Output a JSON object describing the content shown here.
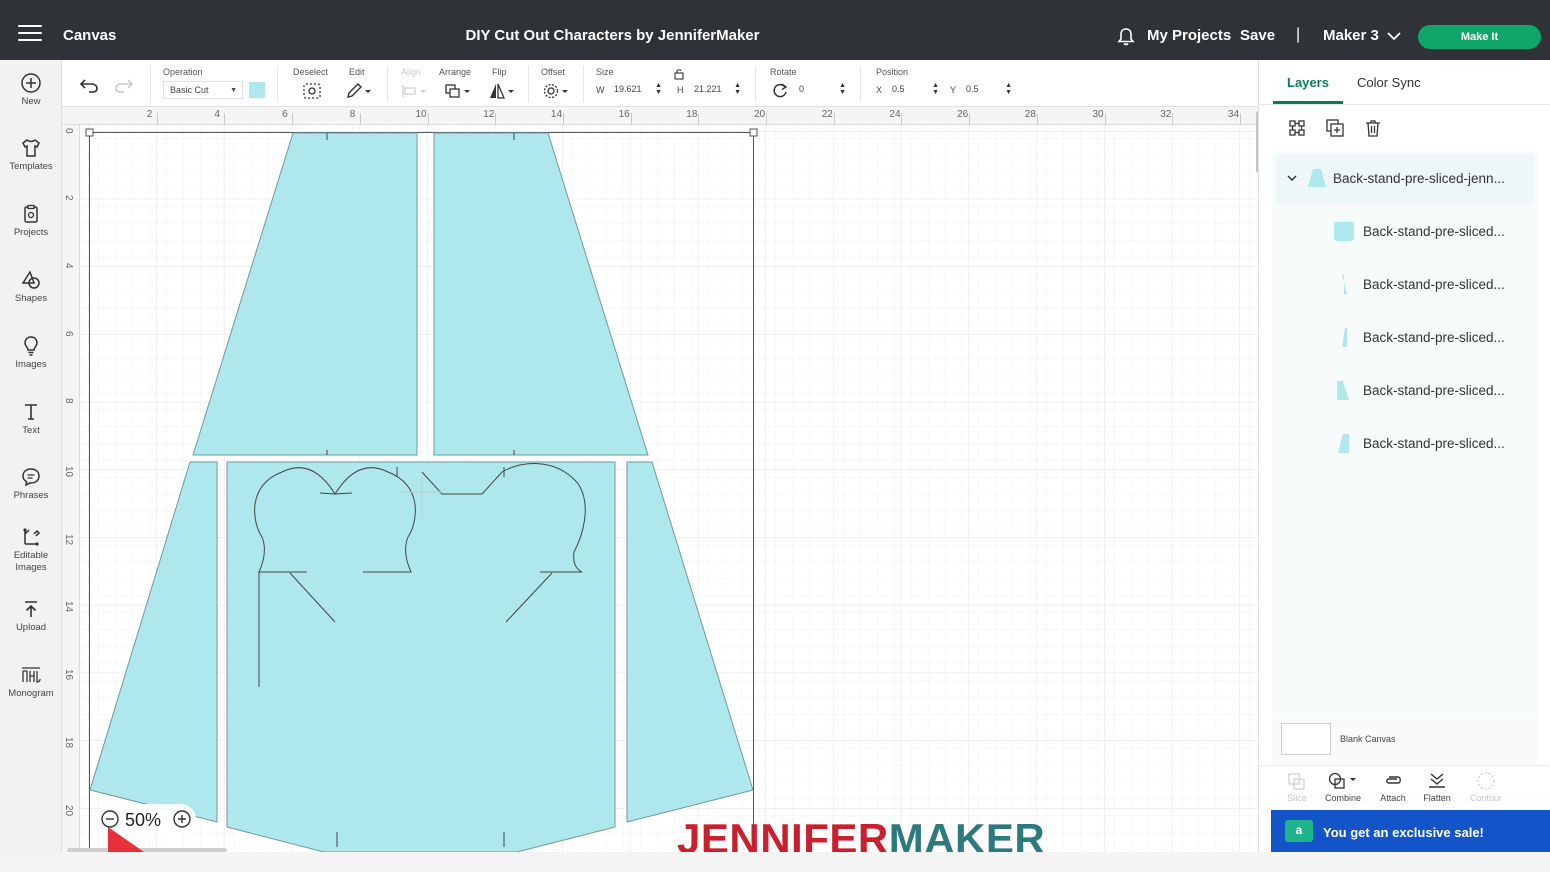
{
  "header": {
    "app_title": "Canvas",
    "project_title": "DIY Cut Out Characters by JenniferMaker",
    "my_projects": "My Projects",
    "save": "Save",
    "separator": "|",
    "machine": "Maker 3",
    "make_it": "Make It"
  },
  "sidebar": {
    "items": [
      {
        "label": "New",
        "icon": "plus-circle-icon"
      },
      {
        "label": "Templates",
        "icon": "shirt-icon"
      },
      {
        "label": "Projects",
        "icon": "clipboard-icon"
      },
      {
        "label": "Shapes",
        "icon": "shapes-icon"
      },
      {
        "label": "Images",
        "icon": "lightbulb-icon"
      },
      {
        "label": "Text",
        "icon": "text-icon"
      },
      {
        "label": "Phrases",
        "icon": "speech-bubble-icon"
      },
      {
        "label": "Editable Images",
        "icon": "editable-images-icon"
      },
      {
        "label": "Upload",
        "icon": "upload-icon"
      },
      {
        "label": "Monogram",
        "icon": "monogram-icon"
      }
    ]
  },
  "toolbar": {
    "operation_label": "Operation",
    "operation_value": "Basic Cut",
    "operation_color": "#aee8ec",
    "deselect_label": "Deselect",
    "edit_label": "Edit",
    "align_label": "Align",
    "arrange_label": "Arrange",
    "flip_label": "Flip",
    "offset_label": "Offset",
    "size_label": "Size",
    "w_letter": "W",
    "w_value": "19.621",
    "h_letter": "H",
    "h_value": "21.221",
    "rotate_label": "Rotate",
    "rotate_value": "0",
    "position_label": "Position",
    "x_letter": "X",
    "x_value": "0.5",
    "y_letter": "Y",
    "y_value": "0.5"
  },
  "canvas": {
    "ruler_top": [
      "2",
      "4",
      "6",
      "8",
      "10",
      "12",
      "14",
      "16",
      "18",
      "20",
      "22",
      "24",
      "26",
      "28",
      "30",
      "32",
      "34"
    ],
    "ruler_left": [
      "0",
      "2",
      "4",
      "6",
      "8",
      "10",
      "12",
      "14",
      "16",
      "18",
      "20"
    ],
    "zoom": "50%",
    "shape_fill": "#aee8ec",
    "watermark_part1": "JENNIFER",
    "watermark_part2": "MAKER"
  },
  "panel": {
    "tab_layers": "Layers",
    "tab_color_sync": "Color Sync",
    "group_name": "Back-stand-pre-sliced-jenn...",
    "layers": [
      "Back-stand-pre-sliced...",
      "Back-stand-pre-sliced...",
      "Back-stand-pre-sliced...",
      "Back-stand-pre-sliced...",
      "Back-stand-pre-sliced..."
    ],
    "blank_canvas": "Blank Canvas",
    "tools": [
      "Slice",
      "Combine",
      "Attach",
      "Flatten",
      "Contour"
    ],
    "sale_text": "You get an exclusive sale!"
  }
}
